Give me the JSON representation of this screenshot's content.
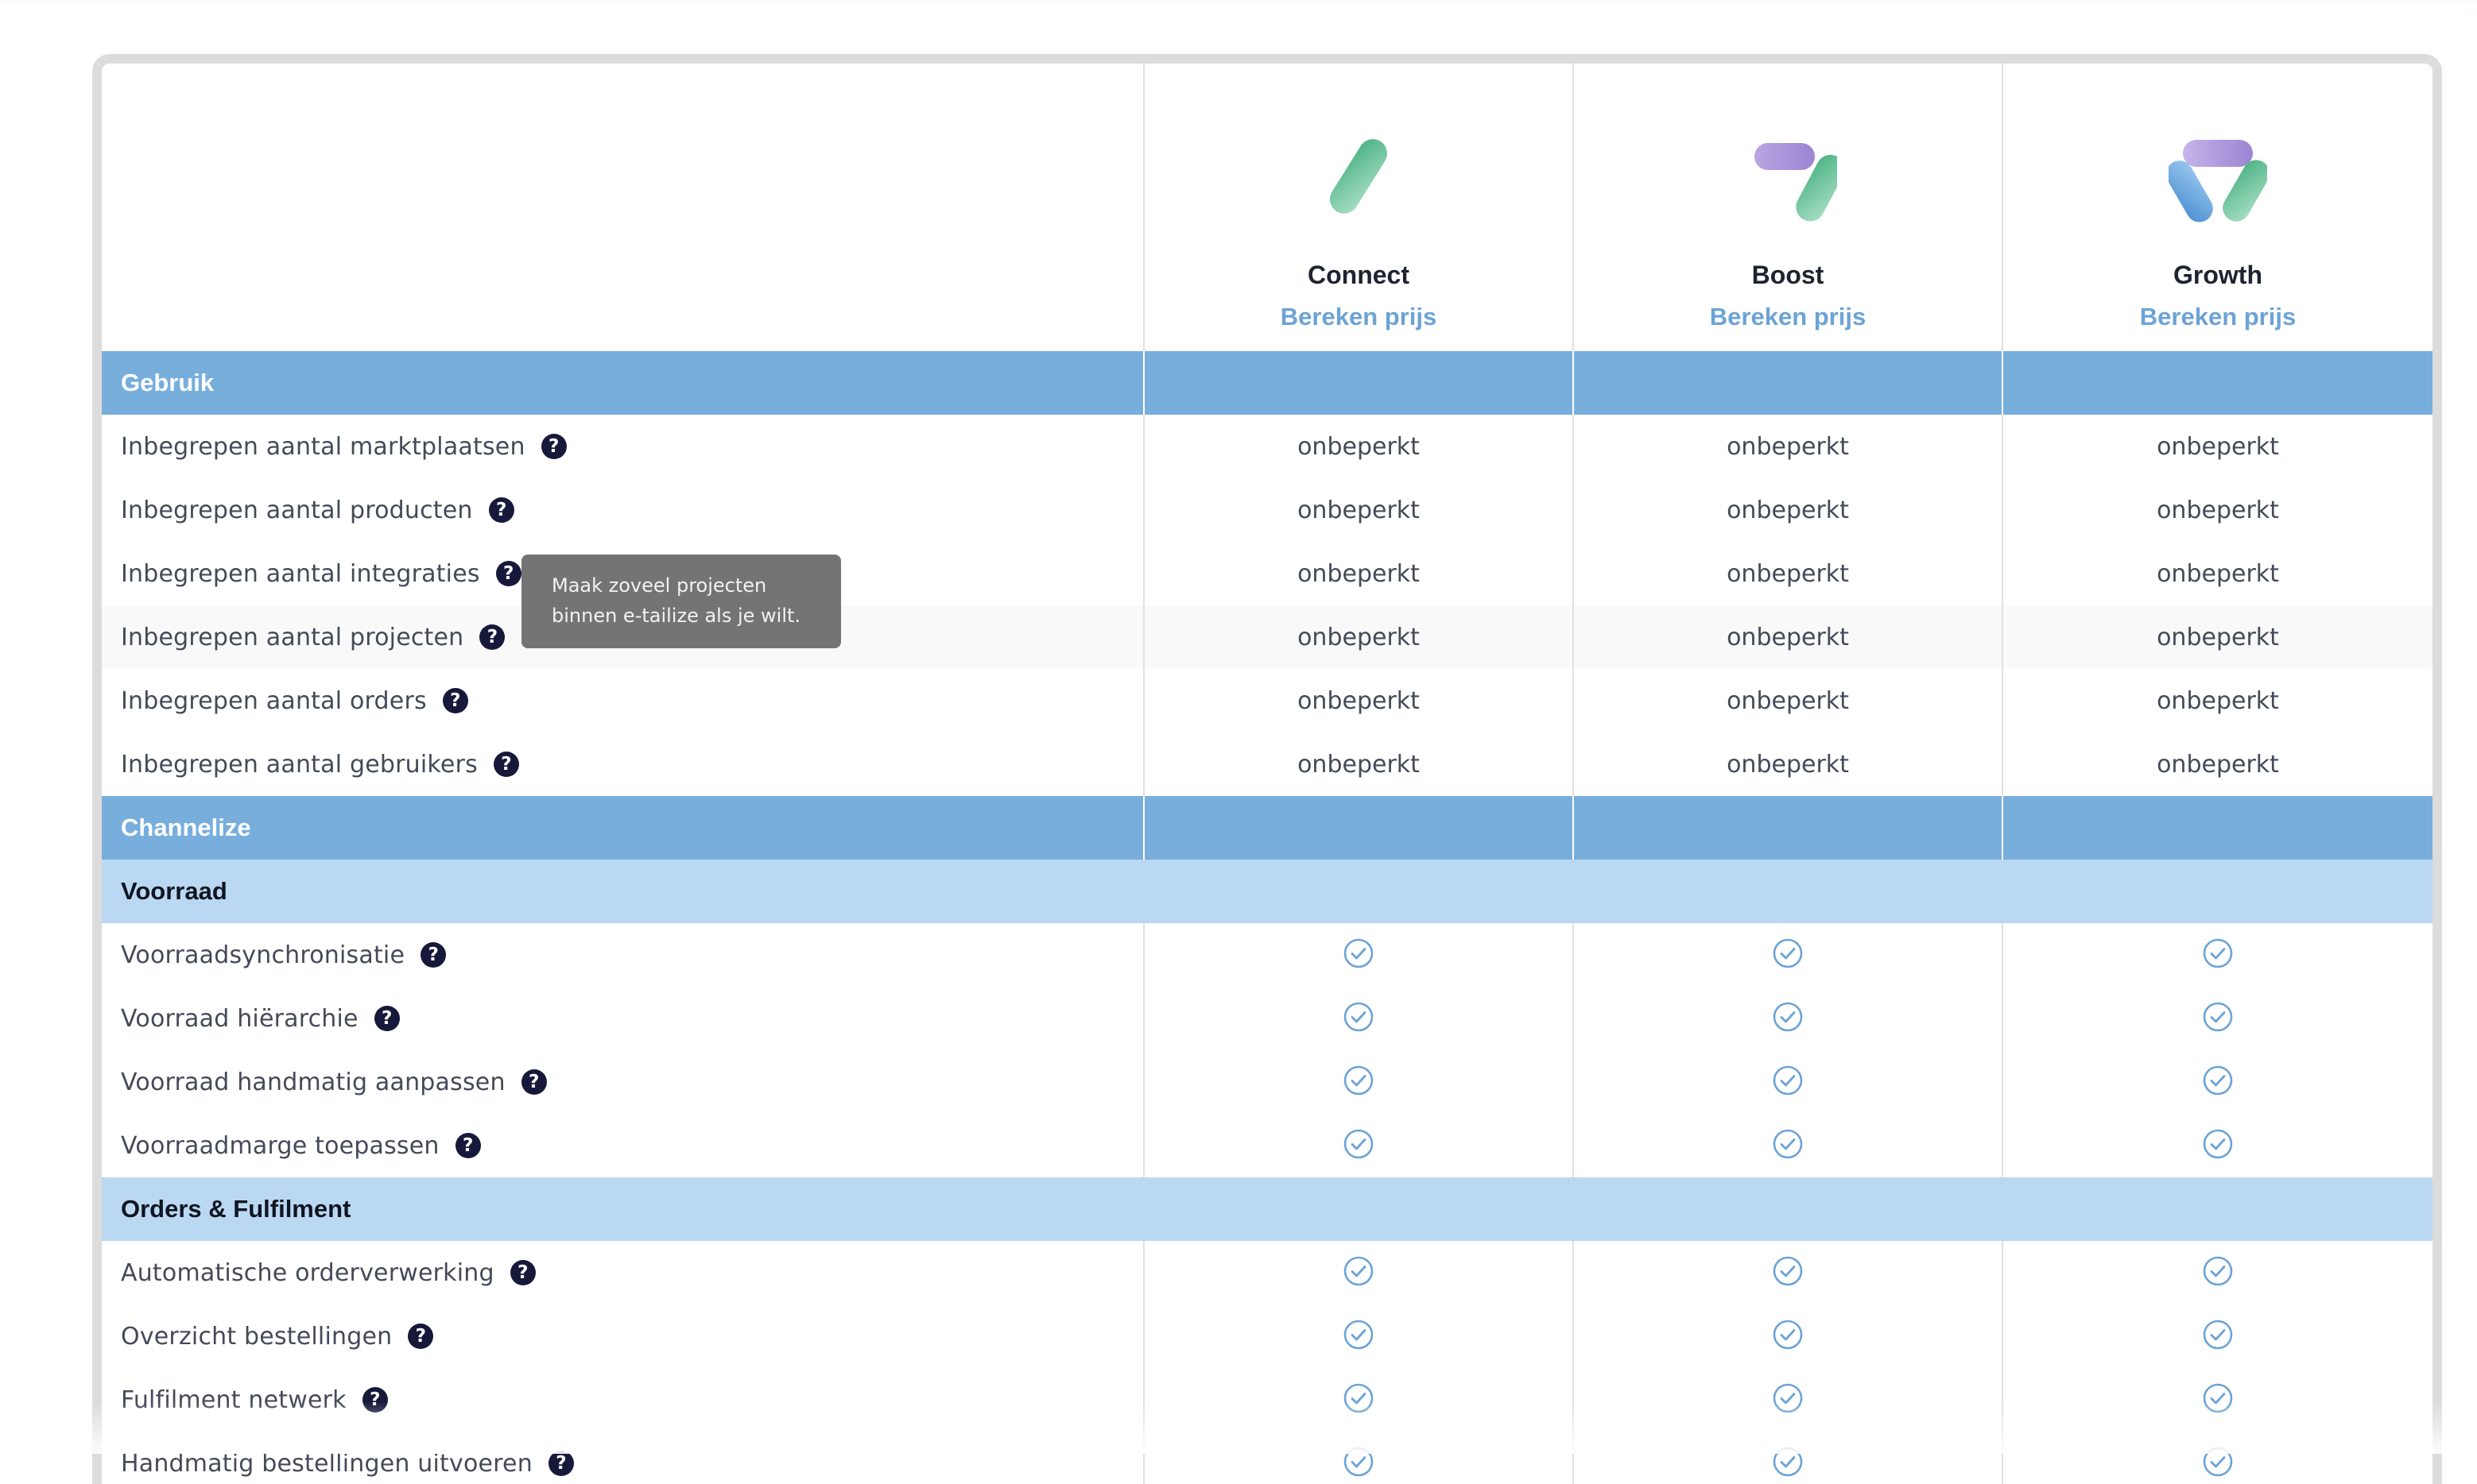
{
  "plans": [
    {
      "name": "Connect",
      "price_link": "Bereken prijs",
      "icon": "connect-logo-icon"
    },
    {
      "name": "Boost",
      "price_link": "Bereken prijs",
      "icon": "boost-logo-icon"
    },
    {
      "name": "Growth",
      "price_link": "Bereken prijs",
      "icon": "growth-logo-icon"
    }
  ],
  "sections": {
    "gebruik": {
      "title": "Gebruik",
      "rows": [
        {
          "label": "Inbegrepen aantal marktplaatsen",
          "values": [
            "onbeperkt",
            "onbeperkt",
            "onbeperkt"
          ]
        },
        {
          "label": "Inbegrepen aantal producten",
          "values": [
            "onbeperkt",
            "onbeperkt",
            "onbeperkt"
          ]
        },
        {
          "label": "Inbegrepen aantal integraties",
          "values": [
            "onbeperkt",
            "onbeperkt",
            "onbeperkt"
          ]
        },
        {
          "label": "Inbegrepen aantal projecten",
          "values": [
            "onbeperkt",
            "onbeperkt",
            "onbeperkt"
          ]
        },
        {
          "label": "Inbegrepen aantal orders",
          "values": [
            "onbeperkt",
            "onbeperkt",
            "onbeperkt"
          ]
        },
        {
          "label": "Inbegrepen aantal gebruikers",
          "values": [
            "onbeperkt",
            "onbeperkt",
            "onbeperkt"
          ]
        }
      ]
    },
    "channelize": {
      "title": "Channelize",
      "voorraad": {
        "title": "Voorraad",
        "rows": [
          {
            "label": "Voorraadsynchronisatie"
          },
          {
            "label": "Voorraad hiërarchie"
          },
          {
            "label": "Voorraad handmatig aanpassen"
          },
          {
            "label": "Voorraadmarge toepassen"
          }
        ]
      },
      "orders": {
        "title": "Orders & Fulfilment",
        "rows": [
          {
            "label": "Automatische orderverwerking"
          },
          {
            "label": "Overzicht bestellingen"
          },
          {
            "label": "Fulfilment netwerk"
          },
          {
            "label": "Handmatig bestellingen uitvoeren"
          }
        ]
      }
    }
  },
  "tooltip": {
    "line1": "Maak zoveel projecten",
    "line2": "binnen e-tailize als je wilt."
  },
  "help_glyph": "?",
  "colors": {
    "section_header": "#77aedc",
    "subsection_header": "#bad8f1",
    "link": "#6ca3d5",
    "check": "#6ca3d5",
    "help_icon": "#17193b",
    "tooltip_bg": "#747474"
  }
}
